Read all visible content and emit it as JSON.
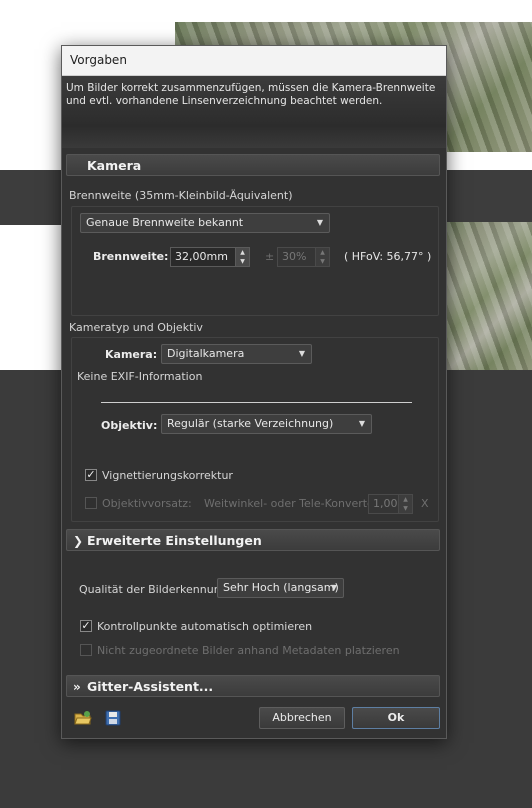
{
  "dialog": {
    "title": "Vorgaben",
    "info": "Um Bilder korrekt zusammenzufügen, müssen die Kamera-Brennweite und evtl. vorhandene Linsenverzeichnung beachtet werden."
  },
  "camera_section": {
    "header": "Kamera",
    "focal_group_label": "Brennweite (35mm-Kleinbild-Äquivalent)",
    "focal_mode": "Genaue Brennweite bekannt",
    "focal_label": "Brennweite:",
    "focal_value": "32,00mm",
    "tolerance_symbol": "±",
    "tolerance_value": "30%",
    "hfov": "( HFoV: 56,77° )",
    "type_group_label": "Kameratyp und Objektiv",
    "camera_label": "Kamera:",
    "camera_value": "Digitalkamera",
    "exif_info": "Keine EXIF-Information",
    "lens_label": "Objektiv:",
    "lens_value": "Regulär  (starke Verzeichnung)",
    "vignetting_label": "Vignettierungskorrektur",
    "vignetting_checked": true,
    "attachment_label": "Objektivvorsatz:",
    "attachment_checked": false,
    "converter_label": "Weitwinkel- oder Tele-Konverter",
    "converter_value": "1,00",
    "converter_unit": "X"
  },
  "advanced_section": {
    "header": "Erweiterte Einstellungen",
    "quality_label": "Qualität der Bilderkennung:",
    "quality_value": "Sehr Hoch (langsam)",
    "optimize_label": "Kontrollpunkte automatisch optimieren",
    "optimize_checked": true,
    "metadata_label": "Nicht zugeordnete Bilder anhand Metadaten platzieren",
    "metadata_checked": false
  },
  "grid_section": {
    "header": "Gitter-Assistent..."
  },
  "footer": {
    "cancel_label": "Abbrechen",
    "ok_label": "Ok",
    "icons": [
      "open-folder-icon",
      "save-floppy-icon"
    ]
  }
}
